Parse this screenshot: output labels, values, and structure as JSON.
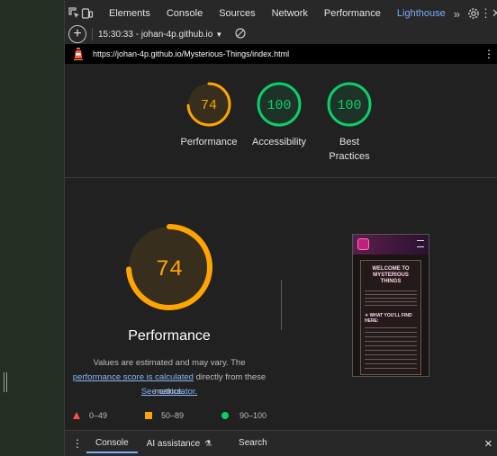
{
  "devtools": {
    "tabs": [
      "Elements",
      "Console",
      "Sources",
      "Network",
      "Performance",
      "Lighthouse"
    ],
    "active_tab": "Lighthouse",
    "report_selector": "15:30:33 - johan-4p.github.io",
    "url": "https://johan-4p.github.io/Mysterious-Things/index.html"
  },
  "scores": [
    {
      "label": "Performance",
      "value": "74",
      "status": "average"
    },
    {
      "label": "Accessibility",
      "value": "100",
      "status": "pass"
    },
    {
      "label": "Best Practices",
      "value": "100",
      "status": "pass"
    }
  ],
  "performance": {
    "score": "74",
    "title": "Performance",
    "note_before": "Values are estimated and may vary. The",
    "link_score": "performance score is calculated",
    "note_middle": "directly from these metrics.",
    "link_calculator": "See calculator."
  },
  "legend": [
    {
      "range": "0–49",
      "color": "#ff4e42"
    },
    {
      "range": "50–89",
      "color": "#ffa400"
    },
    {
      "range": "90–100",
      "color": "#0cce6b"
    }
  ],
  "preview": {
    "heading": "WELCOME TO MYSTERIOUS THINGS",
    "subheading": "✦ WHAT YOU'LL FIND HERE:"
  },
  "drawer": {
    "tabs": [
      "Console",
      "AI assistance",
      "Search"
    ],
    "active": "Console"
  },
  "colors": {
    "average": "#ffa400",
    "pass": "#0cce6b",
    "link": "#8ab4f8",
    "accent": "#7cacf8"
  }
}
